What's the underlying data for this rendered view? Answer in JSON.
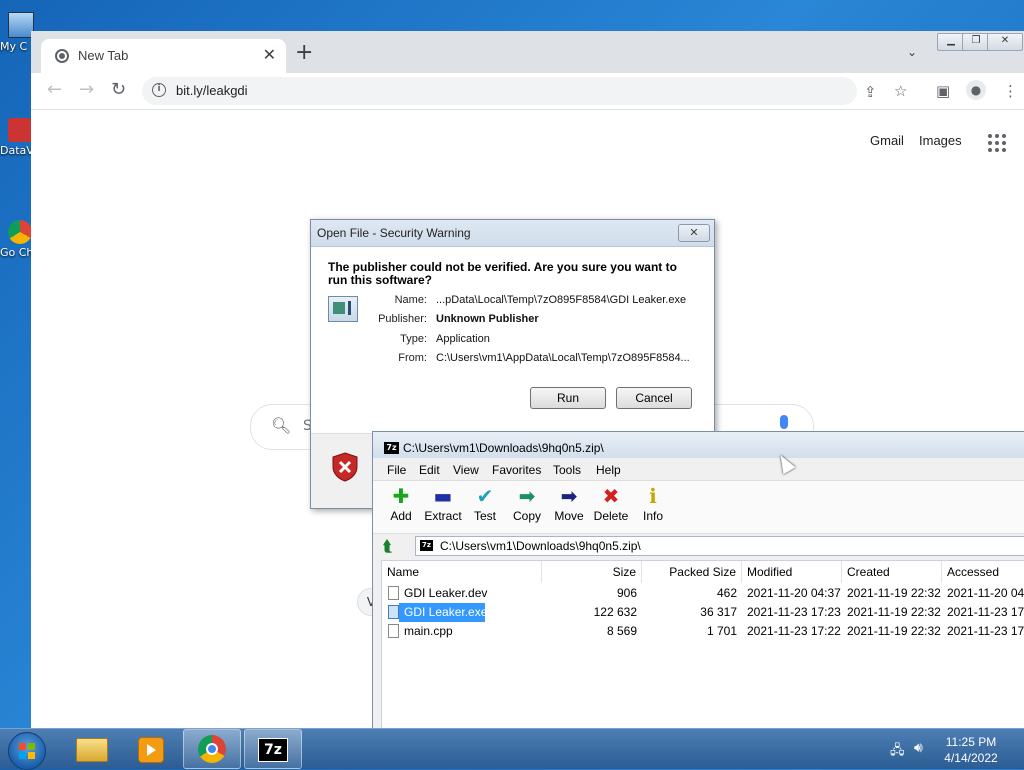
{
  "desktop": {
    "icons": [
      {
        "label": "My C",
        "icon": "computer-icon"
      },
      {
        "label": "DataV",
        "icon": "shortcut-icon"
      },
      {
        "label": "Go Ch",
        "icon": "chrome-shortcut-icon"
      }
    ]
  },
  "chrome": {
    "tab_title": "New Tab",
    "new_tab_label": "+",
    "url": "bit.ly/leakgdi",
    "links": {
      "gmail": "Gmail",
      "images": "Images"
    },
    "search_placeholder": "S"
  },
  "security_warning": {
    "title": "Open File - Security Warning",
    "question": "The publisher could not be verified.  Are you sure you want to run this software?",
    "fields": [
      {
        "label": "Name:",
        "value": "...pData\\Local\\Temp\\7zO895F8584\\GDI Leaker.exe",
        "bold": false
      },
      {
        "label": "Publisher:",
        "value": "Unknown Publisher",
        "bold": true
      },
      {
        "label": "Type:",
        "value": "Application",
        "bold": false
      },
      {
        "label": "From:",
        "value": "C:\\Users\\vm1\\AppData\\Local\\Temp\\7zO895F8584...",
        "bold": false
      }
    ],
    "run_label": "Run",
    "cancel_label": "Cancel"
  },
  "sevenzip": {
    "title": "C:\\Users\\vm1\\Downloads\\9hq0n5.zip\\",
    "menu": [
      "File",
      "Edit",
      "View",
      "Favorites",
      "Tools",
      "Help"
    ],
    "tools": [
      {
        "label": "Add",
        "glyph": "✚",
        "color": "#1aa61a"
      },
      {
        "label": "Extract",
        "glyph": "▬",
        "color": "#1f2fa8"
      },
      {
        "label": "Test",
        "glyph": "✔",
        "color": "#20a0b8"
      },
      {
        "label": "Copy",
        "glyph": "➡",
        "color": "#1c8f6a"
      },
      {
        "label": "Move",
        "glyph": "➡",
        "color": "#1a237e"
      },
      {
        "label": "Delete",
        "glyph": "✖",
        "color": "#d42020"
      },
      {
        "label": "Info",
        "glyph": "ℹ",
        "color": "#c8a400"
      }
    ],
    "path": "C:\\Users\\vm1\\Downloads\\9hq0n5.zip\\",
    "columns": [
      "Name",
      "Size",
      "Packed Size",
      "Modified",
      "Created",
      "Accessed"
    ],
    "rows": [
      {
        "name": "GDI Leaker.dev",
        "size": "906",
        "packed": "462",
        "modified": "2021-11-20 04:37",
        "created": "2021-11-19 22:32",
        "accessed": "2021-11-20 04:"
      },
      {
        "name": "GDI Leaker.exe",
        "size": "122 632",
        "packed": "36 317",
        "modified": "2021-11-23 17:23",
        "created": "2021-11-19 22:32",
        "accessed": "2021-11-23 17:",
        "selected": true
      },
      {
        "name": "main.cpp",
        "size": "8 569",
        "packed": "1 701",
        "modified": "2021-11-23 17:22",
        "created": "2021-11-19 22:32",
        "accessed": "2021-11-23 17:"
      }
    ]
  },
  "taskbar": {
    "time": "11:25 PM",
    "date": "4/14/2022"
  }
}
